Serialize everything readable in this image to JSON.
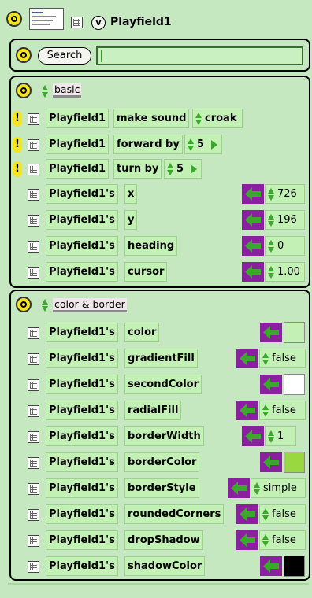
{
  "header": {
    "title": "Playfield1"
  },
  "search": {
    "button_label": "Search",
    "value": ""
  },
  "sections": [
    {
      "title": "basic",
      "rows": [
        {
          "subject": "Playfield1",
          "command": "make sound",
          "arg": "croak",
          "has_bang": true
        },
        {
          "subject": "Playfield1",
          "command": "forward by",
          "arg": "5",
          "has_bang": true
        },
        {
          "subject": "Playfield1",
          "command": "turn by",
          "arg": "5",
          "has_bang": true
        },
        {
          "subject": "Playfield1's",
          "command": "x",
          "value": "726"
        },
        {
          "subject": "Playfield1's",
          "command": "y",
          "value": "196"
        },
        {
          "subject": "Playfield1's",
          "command": "heading",
          "value": "0"
        },
        {
          "subject": "Playfield1's",
          "command": "cursor",
          "value": "1.00"
        }
      ]
    },
    {
      "title": "color & border",
      "rows": [
        {
          "subject": "Playfield1's",
          "command": "color",
          "color": "#c2f0b5"
        },
        {
          "subject": "Playfield1's",
          "command": "gradientFill",
          "value": "false"
        },
        {
          "subject": "Playfield1's",
          "command": "secondColor",
          "color": "#ffffff"
        },
        {
          "subject": "Playfield1's",
          "command": "radialFill",
          "value": "false"
        },
        {
          "subject": "Playfield1's",
          "command": "borderWidth",
          "value": "1"
        },
        {
          "subject": "Playfield1's",
          "command": "borderColor",
          "color": "#9ad83f"
        },
        {
          "subject": "Playfield1's",
          "command": "borderStyle",
          "value": "simple"
        },
        {
          "subject": "Playfield1's",
          "command": "roundedCorners",
          "value": "false"
        },
        {
          "subject": "Playfield1's",
          "command": "dropShadow",
          "value": "false"
        },
        {
          "subject": "Playfield1's",
          "command": "shadowColor",
          "color": "#000000"
        }
      ]
    }
  ],
  "colors": {
    "panel_bg": "#c6e8c0",
    "tile_bg": "#c2f0b5",
    "setter_purple": "#8a1fa0",
    "arrow_green": "#3aa82b",
    "bang_yellow": "#f5e51d"
  }
}
